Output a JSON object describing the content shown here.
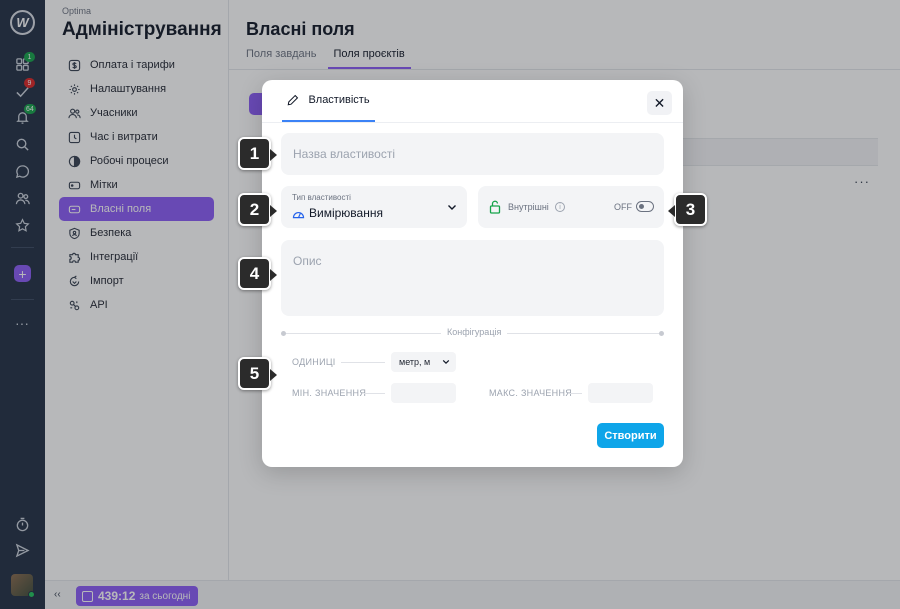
{
  "app": {
    "org_name": "Optima",
    "section_title": "Адміністрування"
  },
  "rail": {
    "badges": {
      "projects": "1",
      "tasks": "9",
      "notifications": "64"
    }
  },
  "sidebar": {
    "items": [
      {
        "label": "Оплата і тарифи",
        "icon": "dollar-icon"
      },
      {
        "label": "Налаштування",
        "icon": "gear-icon"
      },
      {
        "label": "Учасники",
        "icon": "users-icon"
      },
      {
        "label": "Час і витрати",
        "icon": "clock-icon"
      },
      {
        "label": "Робочі процеси",
        "icon": "workflow-icon"
      },
      {
        "label": "Мітки",
        "icon": "tag-icon"
      },
      {
        "label": "Власні поля",
        "icon": "field-icon",
        "active": true
      },
      {
        "label": "Безпека",
        "icon": "shield-icon"
      },
      {
        "label": "Інтеграції",
        "icon": "puzzle-icon"
      },
      {
        "label": "Імпорт",
        "icon": "import-icon"
      },
      {
        "label": "API",
        "icon": "api-icon"
      }
    ]
  },
  "main": {
    "title": "Власні поля",
    "tabs": [
      {
        "label": "Поля завдань"
      },
      {
        "label": "Поля проєктів",
        "active": true
      }
    ]
  },
  "modal": {
    "tab_label": "Властивість",
    "name_placeholder": "Назва властивості",
    "type_label": "Тип властивості",
    "type_value": "Вимірювання",
    "internal_label": "Внутрішні",
    "internal_state": "OFF",
    "description_placeholder": "Опис",
    "config_label": "Конфігурація",
    "units_label": "ОДИНИЦІ",
    "units_value": "метр, м",
    "min_label": "МІН. ЗНАЧЕННЯ",
    "max_label": "МАКС. ЗНАЧЕННЯ",
    "create_label": "Створити"
  },
  "callouts": [
    "1",
    "2",
    "3",
    "4",
    "5"
  ],
  "bottom": {
    "timer_value": "439:12",
    "timer_suffix": "за сьогодні"
  },
  "colors": {
    "accent": "#8b5cf6",
    "primary_button": "#0ea5e9",
    "rail_bg": "#233044"
  }
}
